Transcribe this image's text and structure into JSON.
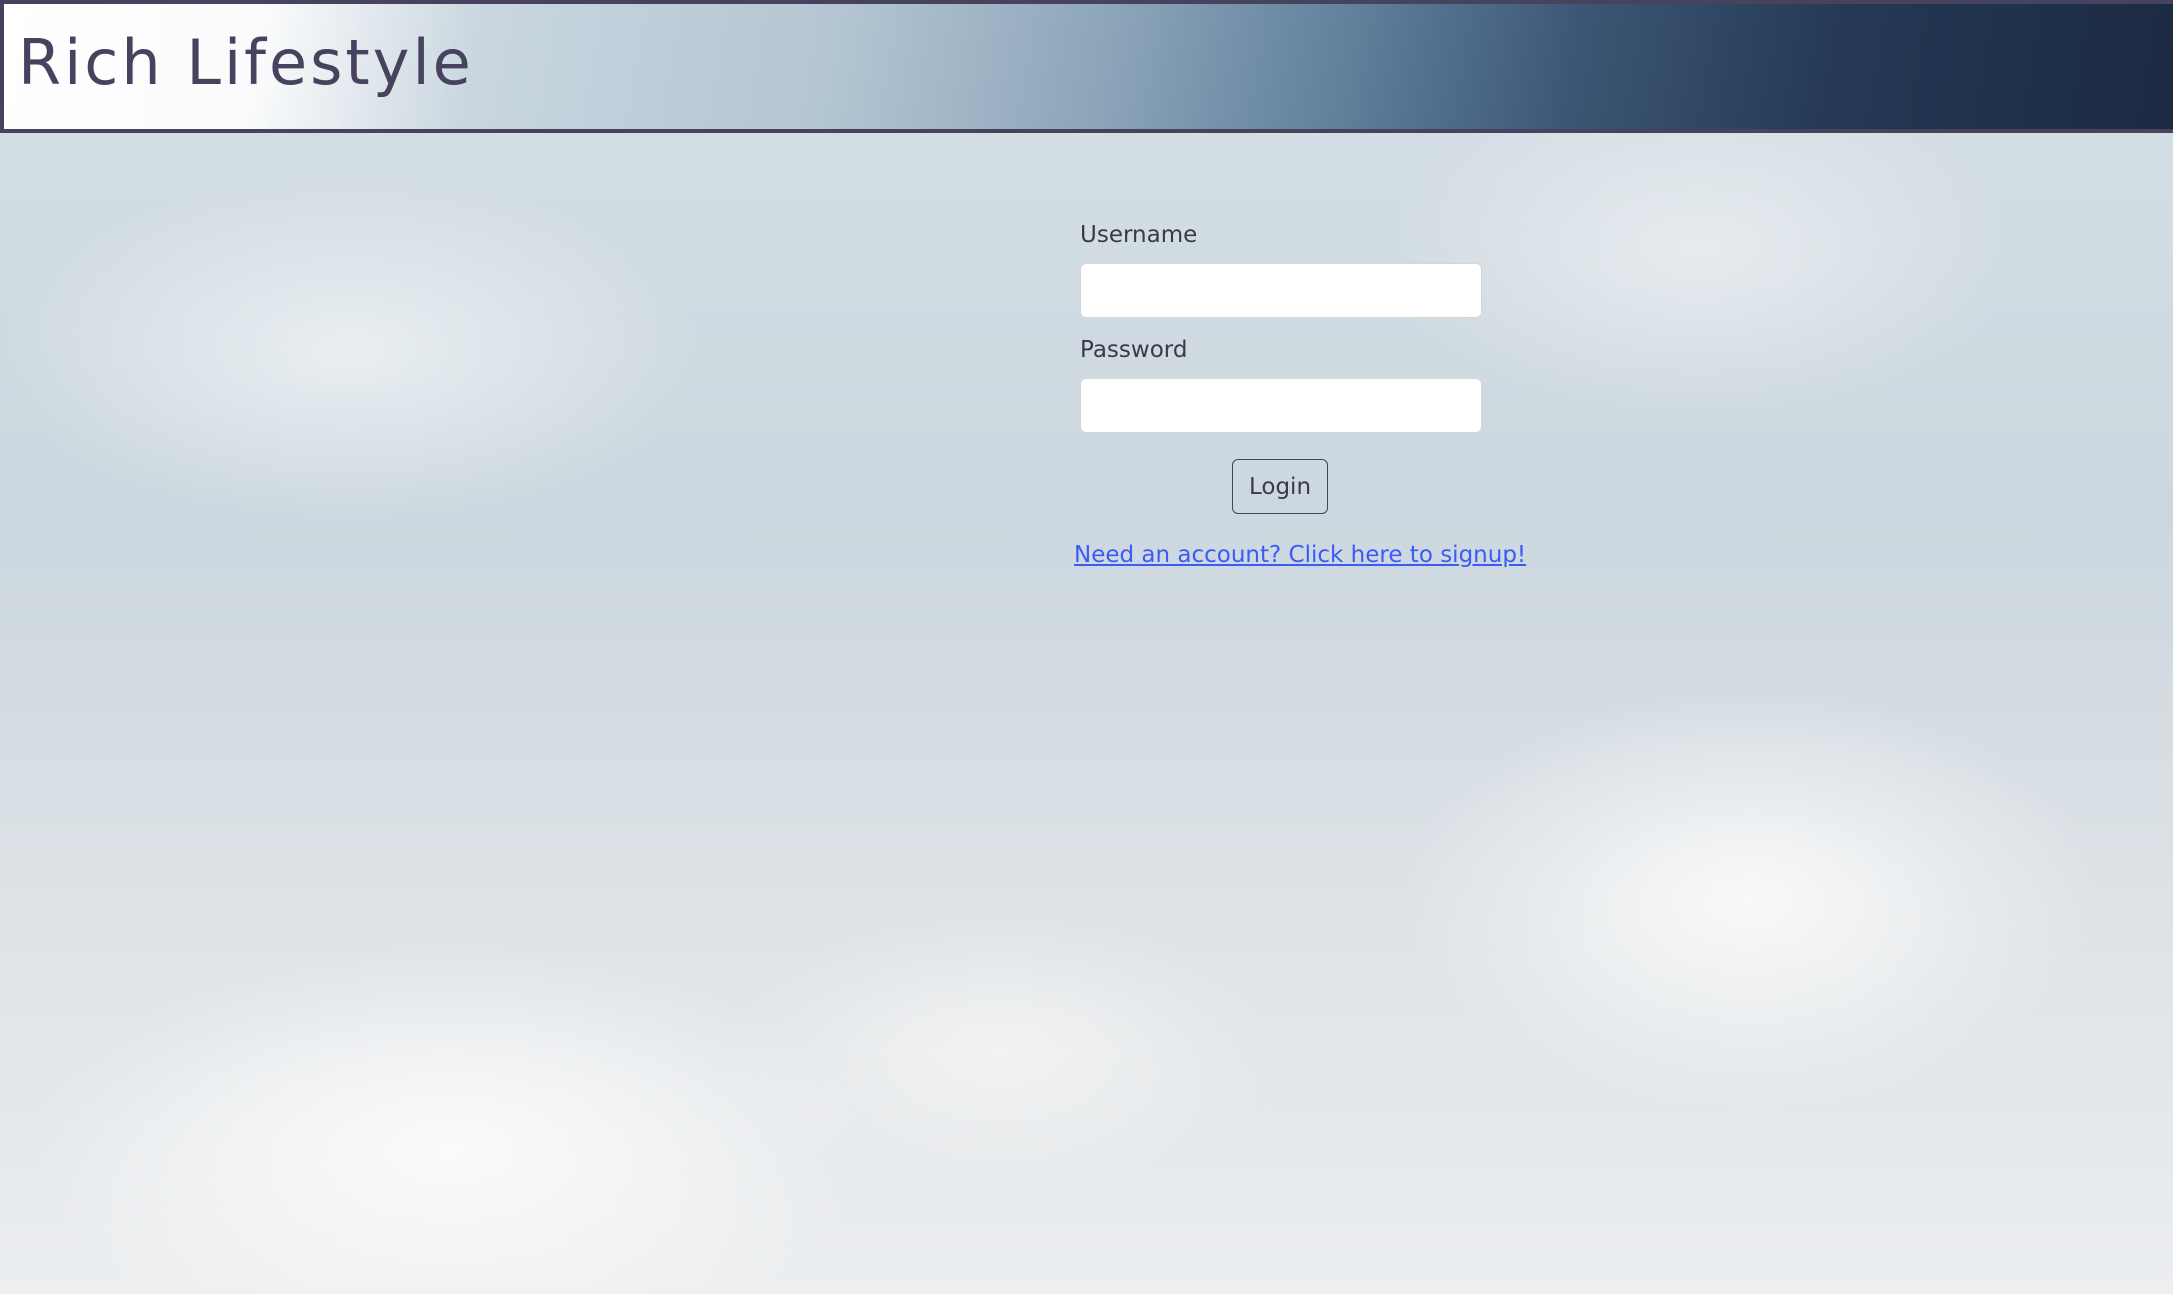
{
  "header": {
    "title": "Rich Lifestyle"
  },
  "form": {
    "username_label": "Username",
    "username_value": "",
    "password_label": "Password",
    "password_value": "",
    "login_label": "Login",
    "signup_link": "Need an account? Click here to signup!"
  }
}
